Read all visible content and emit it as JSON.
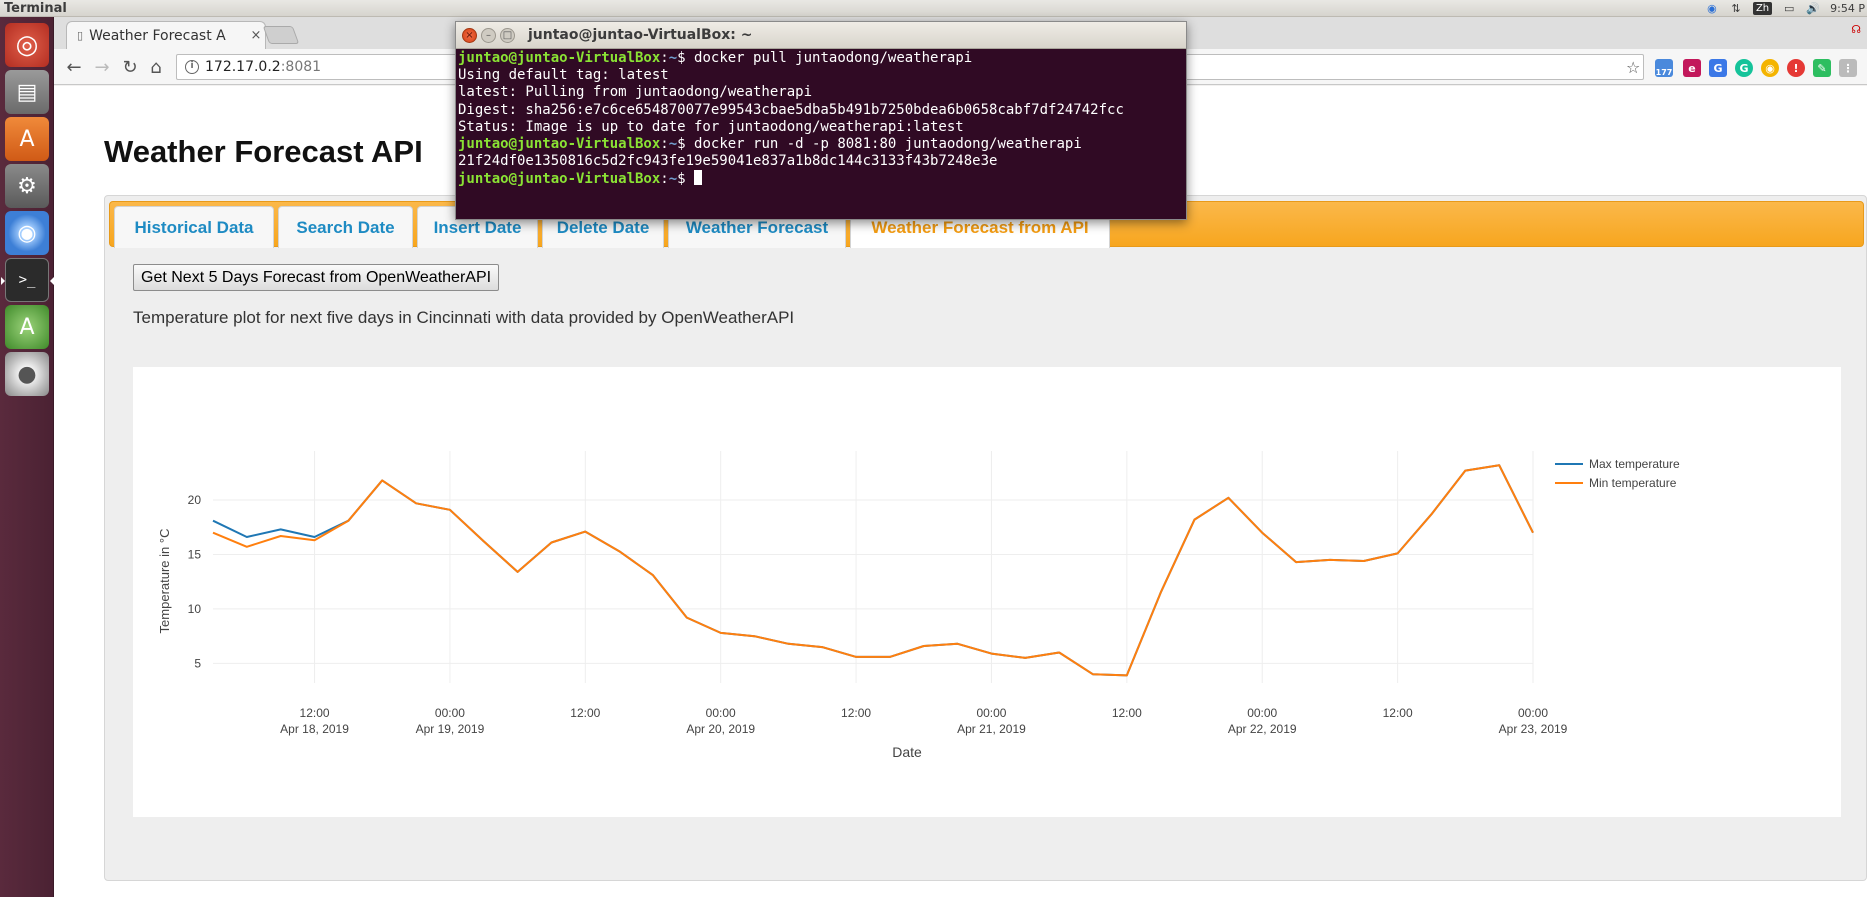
{
  "top_panel": {
    "app_title": "Terminal",
    "clock": "9:54 P",
    "input_method": "Zh"
  },
  "launcher": {
    "items": [
      "ubuntu-home",
      "files",
      "software-center",
      "system-settings",
      "chromium",
      "terminal",
      "software-updater",
      "dvd"
    ]
  },
  "browser": {
    "tab_title": "Weather Forecast A",
    "tab_close": "×",
    "url_host": "172.17.0.2",
    "url_port": ":8081",
    "badge_count": "177"
  },
  "terminal": {
    "title": "juntao@juntao-VirtualBox: ~",
    "lines": [
      {
        "prompt": "juntao@juntao-VirtualBox",
        "path": "~",
        "cmd": "$ docker pull juntaodong/weatherapi"
      },
      {
        "out": "Using default tag: latest"
      },
      {
        "out": "latest: Pulling from juntaodong/weatherapi"
      },
      {
        "out": "Digest: sha256:e7c6ce654870077e99543cbae5dba5b491b7250bdea6b0658cabf7df24742fcc"
      },
      {
        "out": "Status: Image is up to date for juntaodong/weatherapi:latest"
      },
      {
        "prompt": "juntao@juntao-VirtualBox",
        "path": "~",
        "cmd": "$ docker run -d -p 8081:80 juntaodong/weatherapi"
      },
      {
        "out": "21f24df0e1350816c5d2fc943fe19e59041e837a1b8dc144c3133f43b7248e3e"
      },
      {
        "prompt": "juntao@juntao-VirtualBox",
        "path": "~",
        "cmd": "$ "
      }
    ]
  },
  "page": {
    "title": "Weather Forecast API",
    "tabs": [
      {
        "label": "Historical Data",
        "active": false
      },
      {
        "label": "Search Date",
        "active": false
      },
      {
        "label": "Insert Date",
        "active": false
      },
      {
        "label": "Delete Date",
        "active": false
      },
      {
        "label": "Weather Forecast",
        "active": false
      },
      {
        "label": "Weather Forecast from API",
        "active": true
      }
    ],
    "get_button_label": "Get Next 5 Days Forecast from OpenWeatherAPI",
    "description": "Temperature plot for next five days in Cincinnati with data provided by OpenWeatherAPI"
  },
  "chart_data": {
    "type": "line",
    "xlabel": "Date",
    "ylabel": "Temperature in °C",
    "x_hours_ticks": [
      {
        "label": "12:00",
        "sub": "Apr 18, 2019"
      },
      {
        "label": "00:00",
        "sub": "Apr 19, 2019"
      },
      {
        "label": "12:00",
        "sub": ""
      },
      {
        "label": "00:00",
        "sub": "Apr 20, 2019"
      },
      {
        "label": "12:00",
        "sub": ""
      },
      {
        "label": "00:00",
        "sub": "Apr 21, 2019"
      },
      {
        "label": "12:00",
        "sub": ""
      },
      {
        "label": "00:00",
        "sub": "Apr 22, 2019"
      },
      {
        "label": "12:00",
        "sub": ""
      },
      {
        "label": "00:00",
        "sub": "Apr 23, 2019"
      }
    ],
    "x_range": [
      "2019-04-18 03:00",
      "2019-04-23 00:00"
    ],
    "y_ticks": [
      5,
      10,
      15,
      20
    ],
    "ylim": [
      3.2,
      24.5
    ],
    "legend": "top-right",
    "colors": {
      "max": "#1f77b4",
      "min": "#ff7f0e"
    },
    "x": [
      "2019-04-18 03:00",
      "2019-04-18 06:00",
      "2019-04-18 09:00",
      "2019-04-18 12:00",
      "2019-04-18 15:00",
      "2019-04-18 18:00",
      "2019-04-18 21:00",
      "2019-04-19 00:00",
      "2019-04-19 03:00",
      "2019-04-19 06:00",
      "2019-04-19 09:00",
      "2019-04-19 12:00",
      "2019-04-19 15:00",
      "2019-04-19 18:00",
      "2019-04-19 21:00",
      "2019-04-20 00:00",
      "2019-04-20 03:00",
      "2019-04-20 06:00",
      "2019-04-20 09:00",
      "2019-04-20 12:00",
      "2019-04-20 15:00",
      "2019-04-20 18:00",
      "2019-04-20 21:00",
      "2019-04-21 00:00",
      "2019-04-21 03:00",
      "2019-04-21 06:00",
      "2019-04-21 09:00",
      "2019-04-21 12:00",
      "2019-04-21 15:00",
      "2019-04-21 18:00",
      "2019-04-21 21:00",
      "2019-04-22 00:00",
      "2019-04-22 03:00",
      "2019-04-22 06:00",
      "2019-04-22 09:00",
      "2019-04-22 12:00",
      "2019-04-22 15:00",
      "2019-04-22 18:00",
      "2019-04-22 21:00",
      "2019-04-23 00:00"
    ],
    "series": [
      {
        "name": "Max temperature",
        "values": [
          18.1,
          16.6,
          17.3,
          16.6,
          18.1,
          21.8,
          19.7,
          19.1,
          16.2,
          13.4,
          16.1,
          17.1,
          15.3,
          13.1,
          9.2,
          7.8,
          7.5,
          6.8,
          6.5,
          5.6,
          5.6,
          6.6,
          6.8,
          5.9,
          5.5,
          6.0,
          4.0,
          3.9,
          11.5,
          18.2,
          20.2,
          17.0,
          14.3,
          14.5,
          14.4,
          15.1,
          18.7,
          22.7,
          23.2,
          17.0
        ]
      },
      {
        "name": "Min temperature",
        "values": [
          17.0,
          15.7,
          16.7,
          16.3,
          18.1,
          21.8,
          19.7,
          19.1,
          16.2,
          13.4,
          16.1,
          17.1,
          15.3,
          13.1,
          9.2,
          7.8,
          7.5,
          6.8,
          6.5,
          5.6,
          5.6,
          6.6,
          6.8,
          5.9,
          5.5,
          6.0,
          4.0,
          3.9,
          11.5,
          18.2,
          20.2,
          17.0,
          14.3,
          14.5,
          14.4,
          15.1,
          18.7,
          22.7,
          23.2,
          17.0
        ]
      }
    ]
  }
}
